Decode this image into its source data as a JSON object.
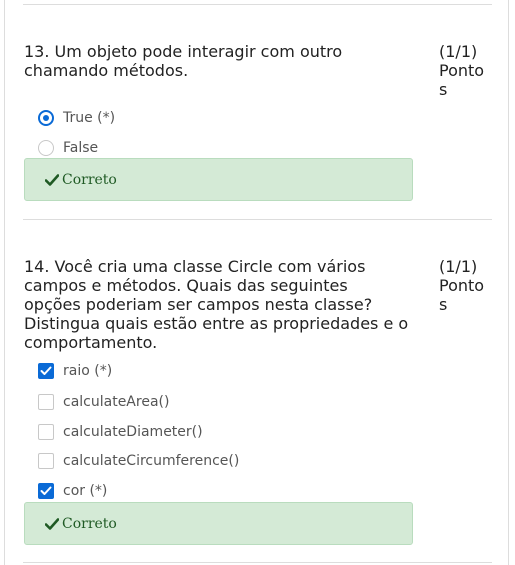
{
  "questions": [
    {
      "number_text": "13. Um objeto pode interagir com outro chamando métodos.",
      "score": "(1/1) Pontos",
      "options": [
        {
          "label": "True (*)",
          "checked": true
        },
        {
          "label": "False",
          "checked": false
        }
      ],
      "feedback": "Correto"
    },
    {
      "number_text": "14. Você cria uma classe Circle com vários campos e métodos. Quais das seguintes opções poderiam ser campos nesta classe? Distingua quais estão entre as propriedades e o comportamento.",
      "score": "(1/1) Pontos",
      "options": [
        {
          "label": "raio (*)",
          "checked": true
        },
        {
          "label": "calculateArea()",
          "checked": false
        },
        {
          "label": "calculateDiameter()",
          "checked": false
        },
        {
          "label": "calculateCircumference()",
          "checked": false
        },
        {
          "label": "cor (*)",
          "checked": true
        }
      ],
      "feedback": "Correto"
    }
  ],
  "colors": {
    "accent": "#0a6ad6",
    "feedback_bg": "#d4ead6",
    "feedback_text": "#1f5a24"
  }
}
